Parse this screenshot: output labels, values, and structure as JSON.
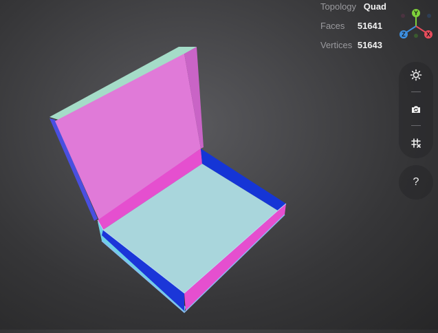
{
  "stats": {
    "topology": {
      "label": "Topology",
      "value": "Quad"
    },
    "faces": {
      "label": "Faces",
      "value": "51641"
    },
    "vertices": {
      "label": "Vertices",
      "value": "51643"
    }
  },
  "gizmo": {
    "y_label": "Y",
    "z_label": "Z",
    "x_label": "X",
    "colors": {
      "y": "#7fd13b",
      "z": "#3d8fe0",
      "x": "#e84c5c"
    }
  },
  "toolbar": {
    "icons": [
      "light-icon",
      "camera-swap-icon",
      "grid-icon"
    ]
  },
  "help": {
    "label": "?"
  },
  "model": {
    "colors": {
      "lid_inner": "#e07ad8",
      "lid_top_edge": "#a5dcc8",
      "base_floor": "#a9d6dc",
      "pink_wall": "#e54fcf",
      "blue_wall": "#1535d6"
    }
  }
}
